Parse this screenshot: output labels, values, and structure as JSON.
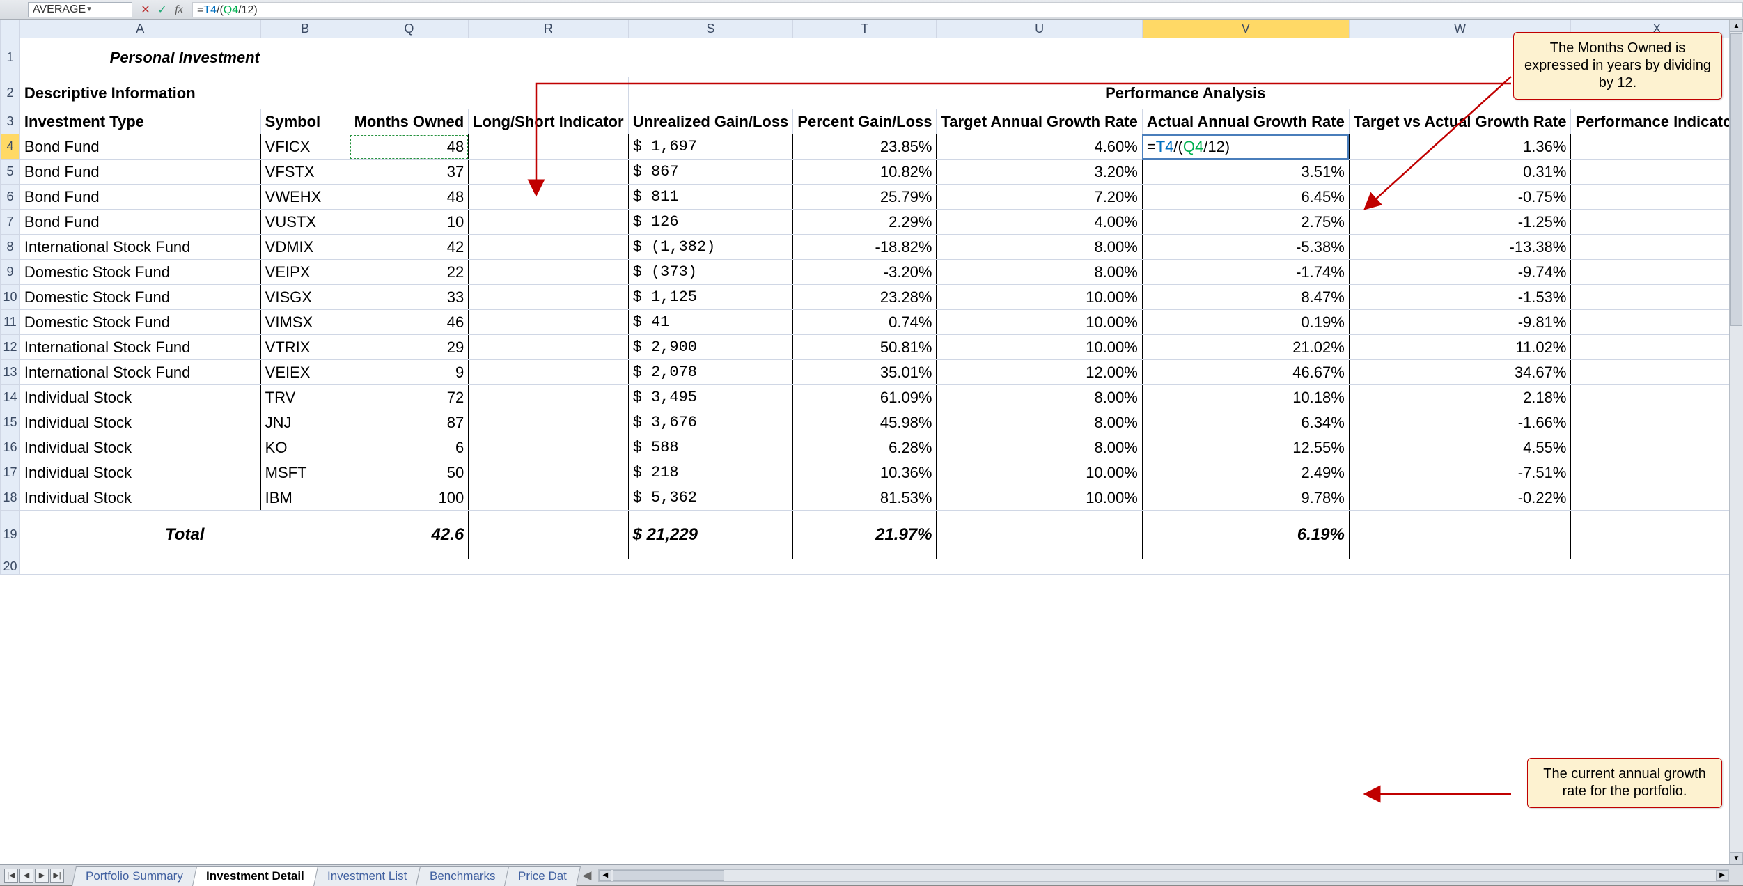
{
  "namebox": "AVERAGE",
  "formula": "=T4/(Q4/12)",
  "formula_parts": {
    "eq": "=",
    "t": "T4",
    "slash1": "/(",
    "q": "Q4",
    "tail": "/12)"
  },
  "columns": [
    "A",
    "B",
    "Q",
    "R",
    "S",
    "T",
    "U",
    "V",
    "W",
    "X"
  ],
  "selected_col": "V",
  "selected_row": "4",
  "row_headers": [
    "1",
    "2",
    "3",
    "4",
    "5",
    "6",
    "7",
    "8",
    "9",
    "10",
    "11",
    "12",
    "13",
    "14",
    "15",
    "16",
    "17",
    "18",
    "19",
    "20"
  ],
  "row1": {
    "title": "Personal Investment"
  },
  "row2": {
    "descriptive": "Descriptive Information",
    "performance": "Performance Analysis"
  },
  "row3": {
    "A": "Investment Type",
    "B": "Symbol",
    "Q": "Months Owned",
    "R": "Long/Short Indicator",
    "S": "Unrealized Gain/Loss",
    "T": "Percent Gain/Loss",
    "U": "Target Annual Growth Rate",
    "V": "Actual Annual Growth Rate",
    "W": "Target vs Actual Growth Rate",
    "X": "Performance Indicator"
  },
  "editing_cell_display": "=T4/(Q4/12)",
  "rows": [
    {
      "A": "Bond Fund",
      "B": "VFICX",
      "Q": "48",
      "R": "",
      "S": "$   1,697",
      "T": "23.85%",
      "U": "4.60%",
      "V_edit": true,
      "W": "1.36%",
      "X": ""
    },
    {
      "A": "Bond Fund",
      "B": "VFSTX",
      "Q": "37",
      "R": "",
      "S": "$      867",
      "T": "10.82%",
      "U": "3.20%",
      "V": "3.51%",
      "W": "0.31%",
      "X": ""
    },
    {
      "A": "Bond Fund",
      "B": "VWEHX",
      "Q": "48",
      "R": "",
      "S": "$      811",
      "T": "25.79%",
      "U": "7.20%",
      "V": "6.45%",
      "W": "-0.75%",
      "X": ""
    },
    {
      "A": "Bond Fund",
      "B": "VUSTX",
      "Q": "10",
      "R": "",
      "S": "$      126",
      "T": "2.29%",
      "U": "4.00%",
      "V": "2.75%",
      "W": "-1.25%",
      "X": ""
    },
    {
      "A": "International Stock Fund",
      "B": "VDMIX",
      "Q": "42",
      "R": "",
      "S": "$ (1,382)",
      "T": "-18.82%",
      "U": "8.00%",
      "V": "-5.38%",
      "W": "-13.38%",
      "X": ""
    },
    {
      "A": "Domestic Stock Fund",
      "B": "VEIPX",
      "Q": "22",
      "R": "",
      "S": "$    (373)",
      "T": "-3.20%",
      "U": "8.00%",
      "V": "-1.74%",
      "W": "-9.74%",
      "X": ""
    },
    {
      "A": "Domestic Stock Fund",
      "B": "VISGX",
      "Q": "33",
      "R": "",
      "S": "$   1,125",
      "T": "23.28%",
      "U": "10.00%",
      "V": "8.47%",
      "W": "-1.53%",
      "X": ""
    },
    {
      "A": "Domestic Stock Fund",
      "B": "VIMSX",
      "Q": "46",
      "R": "",
      "S": "$        41",
      "T": "0.74%",
      "U": "10.00%",
      "V": "0.19%",
      "W": "-9.81%",
      "X": ""
    },
    {
      "A": "International Stock Fund",
      "B": "VTRIX",
      "Q": "29",
      "R": "",
      "S": "$   2,900",
      "T": "50.81%",
      "U": "10.00%",
      "V": "21.02%",
      "W": "11.02%",
      "X": ""
    },
    {
      "A": "International Stock Fund",
      "B": "VEIEX",
      "Q": "9",
      "R": "",
      "S": "$   2,078",
      "T": "35.01%",
      "U": "12.00%",
      "V": "46.67%",
      "W": "34.67%",
      "X": ""
    },
    {
      "A": "Individual Stock",
      "B": "TRV",
      "Q": "72",
      "R": "",
      "S": "$   3,495",
      "T": "61.09%",
      "U": "8.00%",
      "V": "10.18%",
      "W": "2.18%",
      "X": ""
    },
    {
      "A": "Individual Stock",
      "B": "JNJ",
      "Q": "87",
      "R": "",
      "S": "$   3,676",
      "T": "45.98%",
      "U": "8.00%",
      "V": "6.34%",
      "W": "-1.66%",
      "X": ""
    },
    {
      "A": "Individual Stock",
      "B": "KO",
      "Q": "6",
      "R": "",
      "S": "$      588",
      "T": "6.28%",
      "U": "8.00%",
      "V": "12.55%",
      "W": "4.55%",
      "X": ""
    },
    {
      "A": "Individual Stock",
      "B": "MSFT",
      "Q": "50",
      "R": "",
      "S": "$      218",
      "T": "10.36%",
      "U": "10.00%",
      "V": "2.49%",
      "W": "-7.51%",
      "X": ""
    },
    {
      "A": "Individual Stock",
      "B": "IBM",
      "Q": "100",
      "R": "",
      "S": "$   5,362",
      "T": "81.53%",
      "U": "10.00%",
      "V": "9.78%",
      "W": "-0.22%",
      "X": ""
    }
  ],
  "total": {
    "label": "Total",
    "Q": "42.6",
    "S": "$ 21,229",
    "T": "21.97%",
    "V": "6.19%"
  },
  "callouts": {
    "c1": "The Months Owned is expressed in years by dividing by 12.",
    "c2": "The current annual growth rate for the portfolio."
  },
  "tabs": [
    "Portfolio Summary",
    "Investment Detail",
    "Investment List",
    "Benchmarks",
    "Price Dat"
  ],
  "active_tab": "Investment Detail",
  "icons": {
    "cancel": "✕",
    "enter": "✓",
    "fx": "fx",
    "dd": "▼",
    "first": "|◀",
    "prev": "◀",
    "next": "▶",
    "last": "▶|",
    "left": "◀",
    "right": "▶",
    "up": "▲",
    "down": "▼",
    "splitter": "◀"
  }
}
